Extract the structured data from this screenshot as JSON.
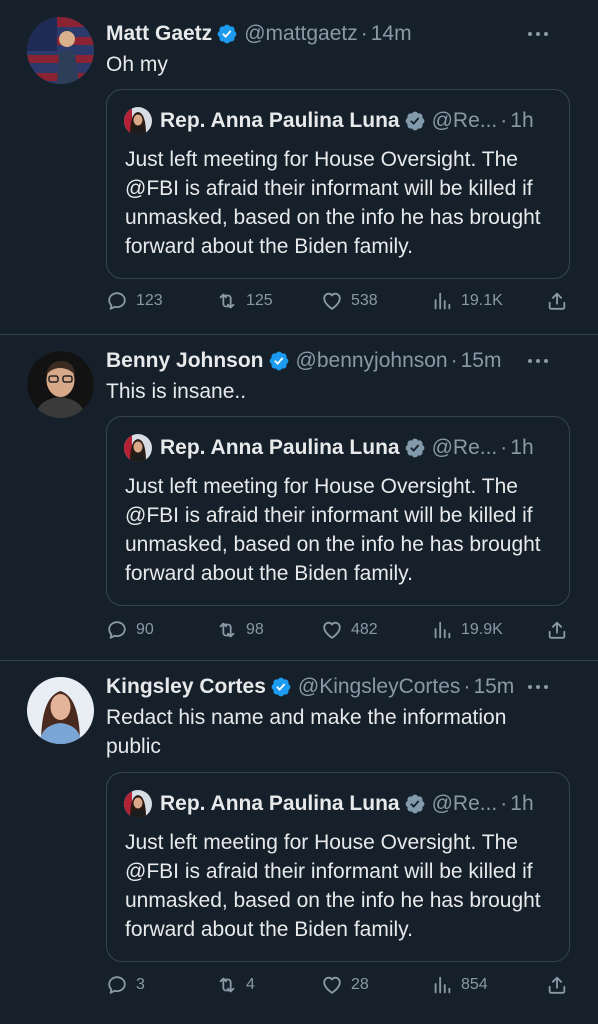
{
  "colors": {
    "background": "#15202b",
    "verified_badge": "#1d9bf0",
    "muted_text": "#8b98a5",
    "divider": "#38444d"
  },
  "icons": {
    "more": "more-horizontal-icon",
    "reply": "reply-icon",
    "retweet": "retweet-icon",
    "like": "heart-icon",
    "views": "views-icon",
    "share": "share-icon",
    "verified": "verified-badge-icon"
  },
  "tweets": [
    {
      "author": {
        "name": "Matt Gaetz",
        "handle": "@mattgaetz",
        "dot": "·",
        "time": "14m"
      },
      "text": "Oh my",
      "quote": {
        "name": "Rep. Anna Paulina Luna",
        "handle": "@Re...",
        "dot": "·",
        "time": "1h",
        "text": "Just left meeting for House Oversight. The @FBI is afraid their informant will be killed if unmasked, based on the info he has brought forward about the Biden family."
      },
      "stats": {
        "replies": "123",
        "retweets": "125",
        "likes": "538",
        "views": "19.1K"
      }
    },
    {
      "author": {
        "name": "Benny Johnson",
        "handle": "@bennyjohnson",
        "dot": "·",
        "time": "15m"
      },
      "text": "This is insane..",
      "quote": {
        "name": "Rep. Anna Paulina Luna",
        "handle": "@Re...",
        "dot": "·",
        "time": "1h",
        "text": "Just left meeting for House Oversight. The @FBI is afraid their informant will be killed if unmasked, based on the info he has brought forward about the Biden family."
      },
      "stats": {
        "replies": "90",
        "retweets": "98",
        "likes": "482",
        "views": "19.9K"
      }
    },
    {
      "author": {
        "name": "Kingsley Cortes",
        "handle": "@KingsleyCortes",
        "dot": "·",
        "time": "15m"
      },
      "text": "Redact his name and make the information public",
      "quote": {
        "name": "Rep. Anna Paulina Luna",
        "handle": "@Re...",
        "dot": "·",
        "time": "1h",
        "text": "Just left meeting for House Oversight. The @FBI is afraid their informant will be killed if unmasked, based on the info he has brought forward about the Biden family."
      },
      "stats": {
        "replies": "3",
        "retweets": "4",
        "likes": "28",
        "views": "854"
      }
    }
  ]
}
